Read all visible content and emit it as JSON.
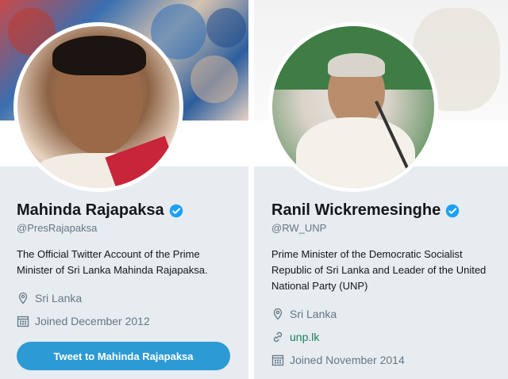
{
  "profiles": [
    {
      "name": "Mahinda Rajapaksa",
      "handle": "@PresRajapaksa",
      "bio": "The Official Twitter Account of the Prime Minister of Sri Lanka Mahinda Rajapaksa.",
      "location": "Sri Lanka",
      "joined": "Joined December 2012",
      "tweet_button": "Tweet to Mahinda Rajapaksa",
      "verified_icon": "verified-badge-icon"
    },
    {
      "name": "Ranil Wickremesinghe",
      "handle": "@RW_UNP",
      "bio": "Prime Minister of the Democratic Socialist Republic of Sri Lanka and Leader of the United National Party (UNP)",
      "location": "Sri Lanka",
      "website": "unp.lk",
      "joined": "Joined November 2014",
      "verified_icon": "verified-badge-icon"
    }
  ],
  "colors": {
    "verified": "#1da1f2",
    "button": "#2c9bd4",
    "card_bg": "#e6ecf0",
    "link": "#1b7f5a",
    "secondary_text": "#657786"
  }
}
